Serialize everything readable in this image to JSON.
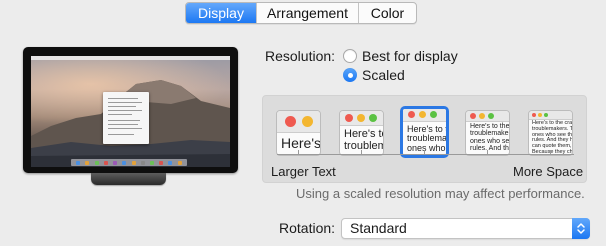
{
  "tabs": [
    {
      "label": "Display",
      "active": true
    },
    {
      "label": "Arrangement",
      "active": false
    },
    {
      "label": "Color",
      "active": false
    }
  ],
  "resolution": {
    "label": "Resolution:",
    "options": [
      {
        "label": "Best for display",
        "selected": false
      },
      {
        "label": "Scaled",
        "selected": true
      }
    ]
  },
  "scaled_options": [
    {
      "sample_text": "Here's",
      "selected": false
    },
    {
      "sample_text": "Here's to\ntroublem",
      "selected": false
    },
    {
      "sample_text": "Here's to th\ntroublemak\nones who se",
      "selected": true
    },
    {
      "sample_text": "Here's to the cr\ntroublemakers.\nones who see th\nrules. And they",
      "selected": false
    },
    {
      "sample_text": "Here's to the crazy ones\ntroublemakers. The rou\nones who see things di\nrules. And they have n\ncan quote them, disag\nBecause they change",
      "selected": false
    }
  ],
  "scale_labels": {
    "left": "Larger Text",
    "right": "More Space"
  },
  "note": "Using a scaled resolution may affect performance.",
  "rotation": {
    "label": "Rotation:",
    "value": "Standard"
  },
  "colors": {
    "accent": "#1c78f3",
    "traffic_red": "#ef5a50",
    "traffic_yellow": "#f3b630",
    "traffic_green": "#5bc243"
  },
  "icons": {
    "popup_arrows": "chevron-up-down-icon"
  }
}
